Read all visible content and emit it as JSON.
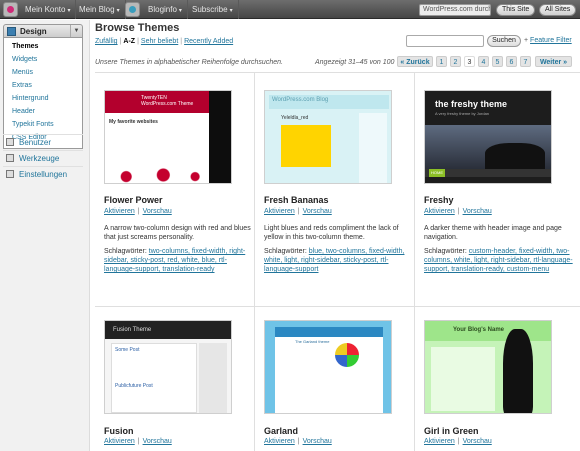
{
  "topbar": {
    "items": [
      {
        "label": "Mein Konto"
      },
      {
        "label": "Mein Blog"
      },
      {
        "label": "Bloginfo"
      },
      {
        "label": "Subscribe"
      }
    ],
    "search_placeholder": "WordPress.com durchs",
    "this_site": "This Site",
    "all_sites": "All Sites"
  },
  "sidebar": {
    "design_label": "Design",
    "sub_items": [
      "Themes",
      "Widgets",
      "Menüs",
      "Extras",
      "Hintergrund",
      "Header",
      "Typekit Fonts",
      "CSS Editor"
    ],
    "active_sub": "Themes",
    "items": [
      {
        "label": "Benutzer",
        "icon": "users-icon"
      },
      {
        "label": "Werkzeuge",
        "icon": "tools-icon"
      },
      {
        "label": "Einstellungen",
        "icon": "settings-icon"
      }
    ]
  },
  "main": {
    "title": "Browse Themes",
    "filter_tabs": [
      "Zufällig",
      "A-Z",
      "Sehr beliebt",
      "Recently Added"
    ],
    "active_filter": "A-Z",
    "search_button": "Suchen",
    "feature_filter_prefix": "+",
    "feature_filter_label": "Feature Filter",
    "sort_note": "Unsere Themes in alphabetischer Reihenfolge durchsuchen.",
    "range_text": "Angezeigt 31–45 von 100",
    "pagination": [
      "« Zurück",
      "1",
      "2",
      "3",
      "4",
      "5",
      "6",
      "7",
      "Weiter »"
    ],
    "current_page": "3"
  },
  "themes": [
    {
      "name": "Flower Power",
      "activate": "Aktivieren",
      "preview": "Vorschau",
      "description": "A narrow two-column design with red and blues that just screams personality.",
      "tags_label": "Schlagwörter:",
      "tags": "two-columns, fixed-width, right-sidebar, sticky-post, red, white, blue, rtl-language-support, translation-ready"
    },
    {
      "name": "Fresh Bananas",
      "activate": "Aktivieren",
      "preview": "Vorschau",
      "description": "Light blues and reds compliment the lack of yellow in this two-column theme.",
      "tags_label": "Schlagwörter:",
      "tags": "blue, two-columns, fixed-width, white, light, right-sidebar, sticky-post, rtl-language-support"
    },
    {
      "name": "Freshy",
      "activate": "Aktivieren",
      "preview": "Vorschau",
      "description": "A darker theme with header image and page navigation.",
      "tags_label": "Schlagwörter:",
      "tags": "custom-header, fixed-width, two-columns, white, light, right-sidebar, rtl-language-support, translation-ready, custom-menu"
    },
    {
      "name": "Fusion",
      "activate": "Aktivieren",
      "preview": "Vorschau"
    },
    {
      "name": "Garland",
      "activate": "Aktivieren",
      "preview": "Vorschau"
    },
    {
      "name": "Girl in Green",
      "activate": "Aktivieren",
      "preview": "Vorschau"
    }
  ],
  "thumbnails": {
    "flower_power_title": "TwentyTEN\nWordPress.com Theme",
    "flower_power_post": "My favorite websites",
    "fresh_bananas_head": "WordPress.com Blog",
    "fresh_bananas_post": "Yeleldla_red",
    "freshy_logo": "the freshy theme",
    "freshy_tagline": "A very freshy theme by Jordan",
    "freshy_nav_home": "HOME",
    "fusion_logo": "Fusion Theme",
    "fusion_post1": "Some Post",
    "fusion_post2": "Publicfuture Post",
    "garland_heading": "The Garland theme",
    "girl_title": "Your Blog's Name"
  }
}
